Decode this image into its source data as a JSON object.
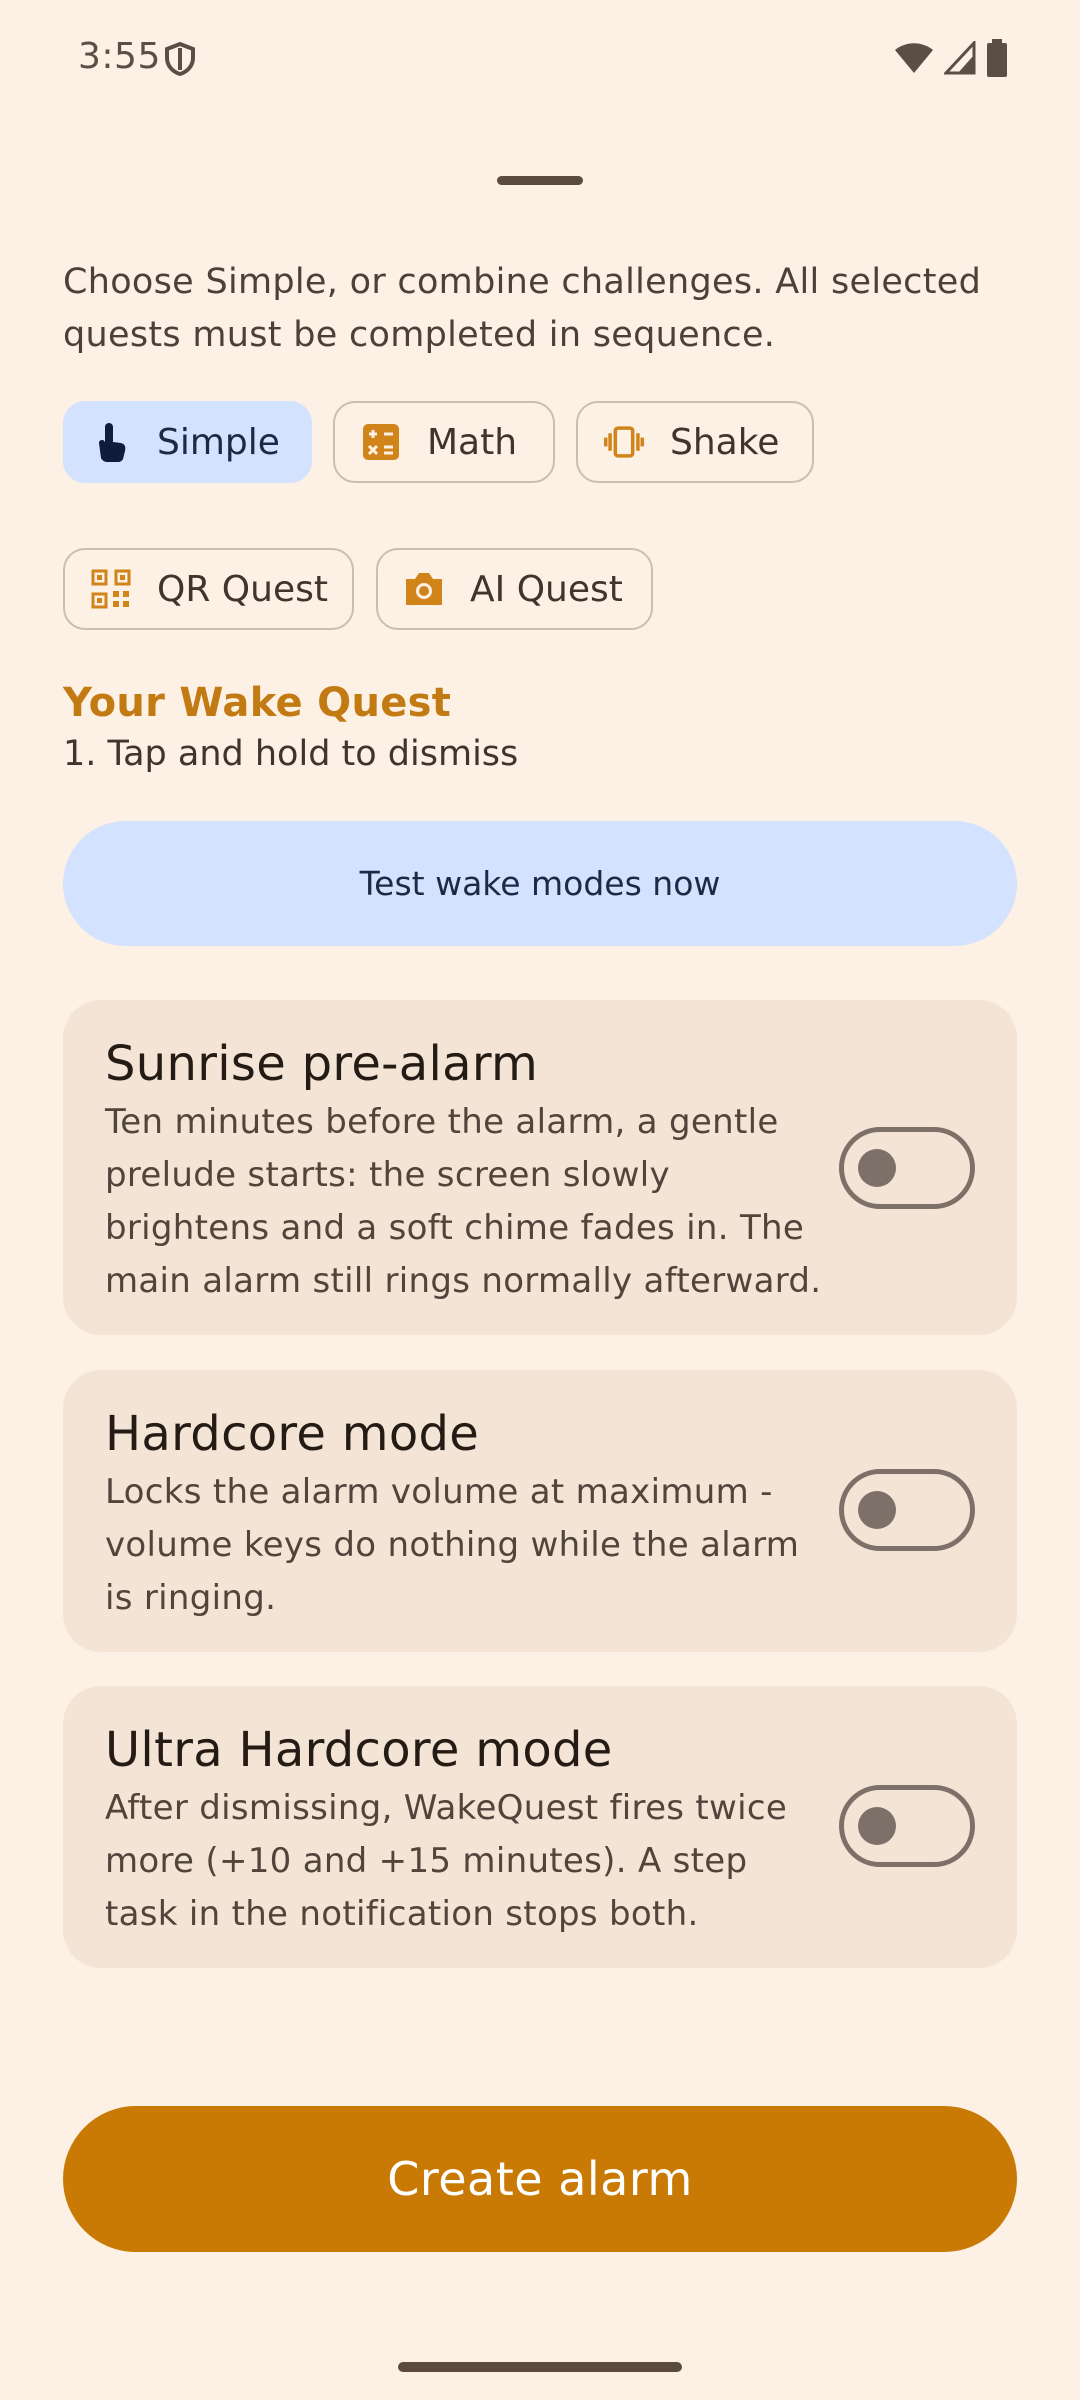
{
  "status_bar": {
    "time": "3:55"
  },
  "intro_text": "Choose Simple, or combine challenges. All selected quests must be completed in sequence.",
  "chips": [
    {
      "label": "Simple",
      "icon": "touch-icon",
      "selected": true
    },
    {
      "label": "Math",
      "icon": "calculator-icon",
      "selected": false
    },
    {
      "label": "Shake",
      "icon": "vibrate-icon",
      "selected": false
    },
    {
      "label": "QR Quest",
      "icon": "qr-code-icon",
      "selected": false
    },
    {
      "label": "AI Quest",
      "icon": "camera-icon",
      "selected": false
    }
  ],
  "quest": {
    "title": "Your Wake Quest",
    "steps": [
      "1.  Tap and hold to dismiss"
    ]
  },
  "test_button_label": "Test wake modes now",
  "cards": [
    {
      "title": "Sunrise pre-alarm",
      "description": "Ten minutes before the alarm, a gentle prelude starts: the screen slowly brightens and a soft chime fades in. The main alarm still rings normally afterward.",
      "enabled": false
    },
    {
      "title": "Hardcore mode",
      "description": "Locks the alarm volume at maximum - volume keys do nothing while the alarm is ringing.",
      "enabled": false
    },
    {
      "title": "Ultra Hardcore mode",
      "description": "After dismissing, WakeQuest fires twice more (+10 and +15 minutes). A step task in the notification stops both.",
      "enabled": false
    }
  ],
  "create_button_label": "Create alarm",
  "colors": {
    "background": "#fdf0e4",
    "accent": "#c87a05",
    "selected_chip": "#d3e2ff",
    "card": "#f3e4d6"
  }
}
